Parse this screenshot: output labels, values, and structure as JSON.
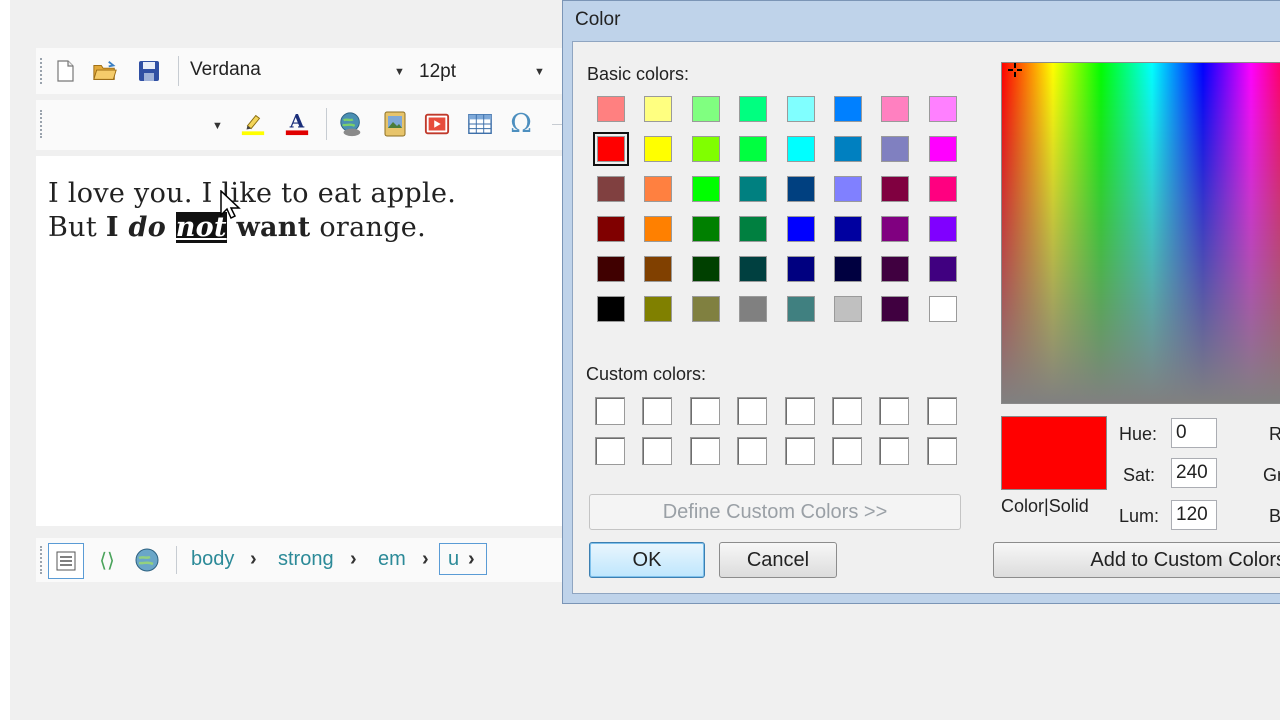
{
  "editor": {
    "toolbar1": {
      "font_name": "Verdana",
      "font_size": "12pt"
    },
    "toolbar2": {
      "format_value": ""
    },
    "content": {
      "line1": "I love you. I like to eat apple.",
      "line2_pre": "But ",
      "line2_strong_i": "I",
      "line2_em_do": "do",
      "line2_selected": "not",
      "line2_strong_want": "want",
      "line2_post": " orange."
    },
    "breadcrumb": [
      "body",
      "strong",
      "em",
      "u"
    ]
  },
  "dialog": {
    "title": "Color",
    "basic_colors_label": "Basic colors:",
    "custom_colors_label": "Custom colors:",
    "define_custom_label": "Define Custom Colors >>",
    "ok_label": "OK",
    "cancel_label": "Cancel",
    "color_solid_label": "Color|Solid",
    "add_custom_label": "Add to Custom Colors",
    "hue_label": "Hue:",
    "sat_label": "Sat:",
    "lum_label": "Lum:",
    "hue_value": "0",
    "sat_value": "240",
    "lum_value": "120",
    "red_label": "Re",
    "green_label": "Gre",
    "blue_label": "Blu",
    "selected_color": "#ff0000",
    "selected_index": 8,
    "basic_colors": [
      "#ff8080",
      "#ffff80",
      "#80ff80",
      "#00ff80",
      "#80ffff",
      "#0080ff",
      "#ff80c0",
      "#ff80ff",
      "#ff0000",
      "#ffff00",
      "#80ff00",
      "#00ff40",
      "#00ffff",
      "#0080c0",
      "#8080c0",
      "#ff00ff",
      "#804040",
      "#ff8040",
      "#00ff00",
      "#008080",
      "#004080",
      "#8080ff",
      "#800040",
      "#ff0080",
      "#800000",
      "#ff8000",
      "#008000",
      "#008040",
      "#0000ff",
      "#0000a0",
      "#800080",
      "#8000ff",
      "#400000",
      "#804000",
      "#004000",
      "#004040",
      "#000080",
      "#000040",
      "#400040",
      "#400080",
      "#000000",
      "#808000",
      "#808040",
      "#808080",
      "#408080",
      "#c0c0c0",
      "#400040",
      "#ffffff"
    ]
  }
}
